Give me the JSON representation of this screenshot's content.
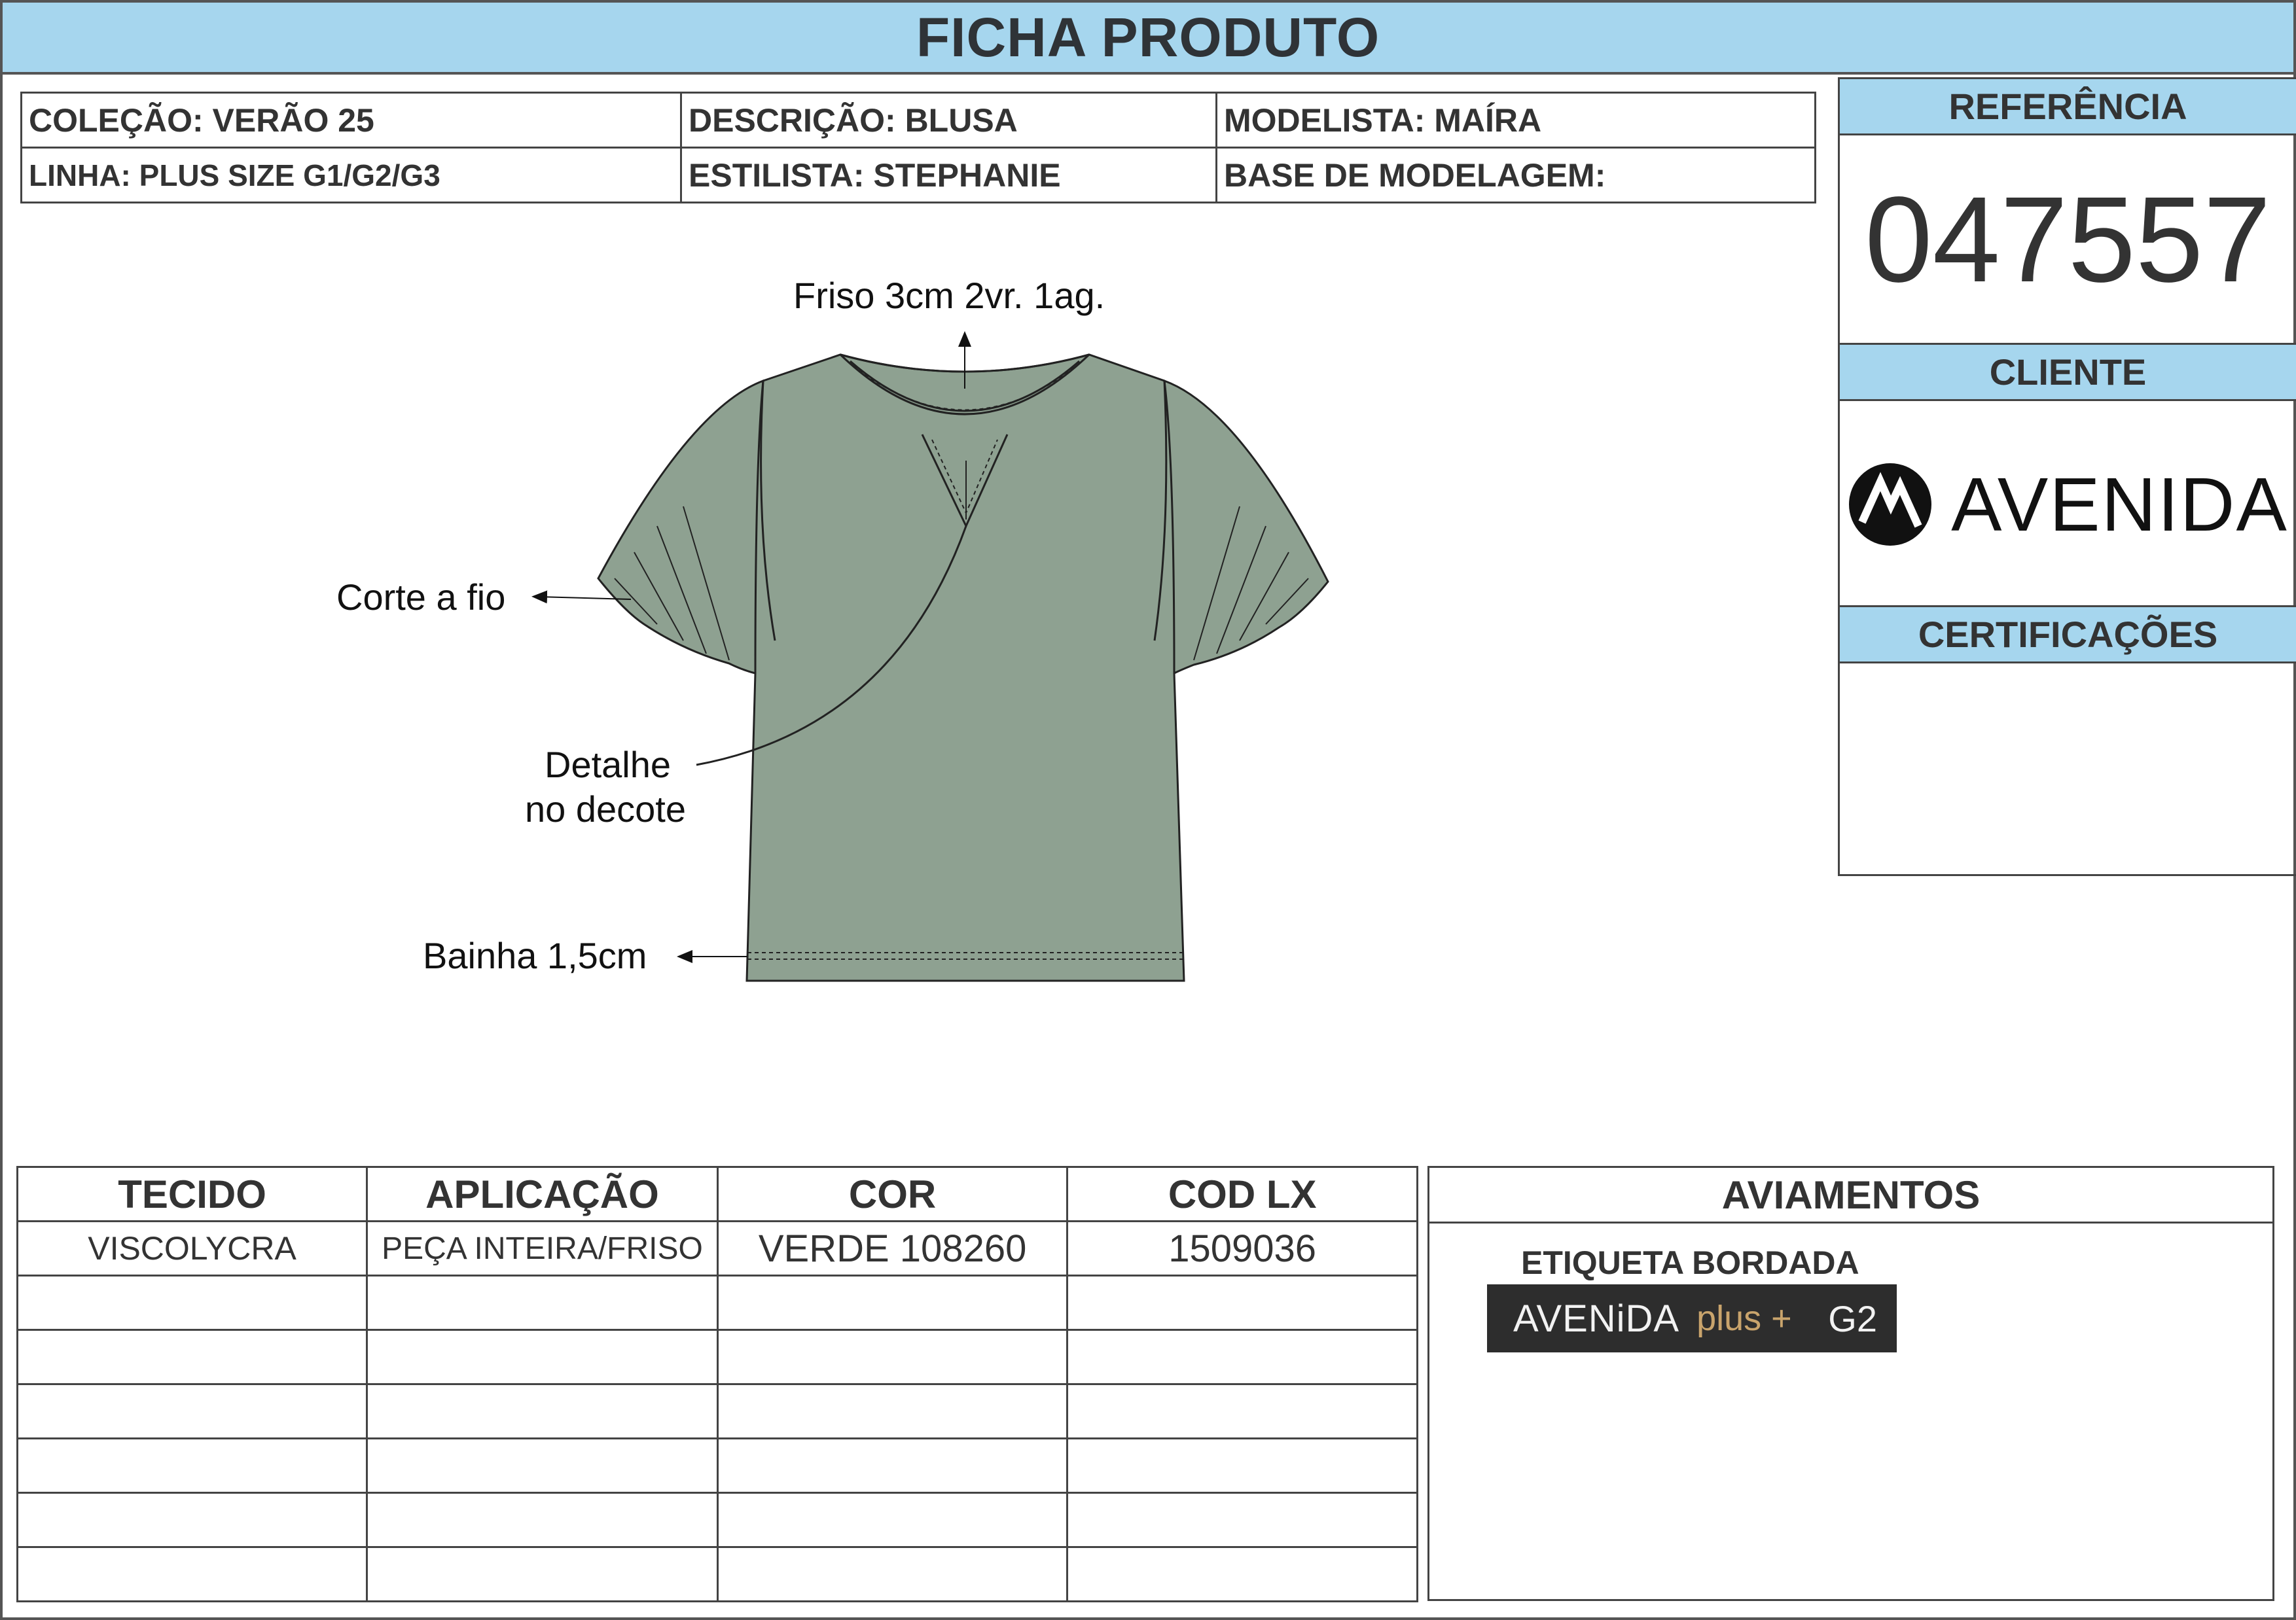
{
  "title": "FICHA PRODUTO",
  "info": {
    "colecao": "COLEÇÃO: VERÃO 25",
    "descricao": "DESCRIÇÃO: BLUSA",
    "modelista": "MODELISTA: MAÍRA",
    "linha": "LINHA: PLUS SIZE G1/G2/G3",
    "estilista": "ESTILISTA: STEPHANIE",
    "base": "BASE DE MODELAGEM:"
  },
  "referencia": {
    "label": "REFERÊNCIA",
    "value": "047557"
  },
  "cliente": {
    "label": "CLIENTE",
    "logo_text": "AVENIDA",
    "logo_icon": "avenida-logo-icon"
  },
  "certificacoes": {
    "label": "CERTIFICAÇÕES"
  },
  "garment": {
    "fill_color": "#8ea191",
    "callouts": {
      "friso": "Friso 3cm 2vr. 1ag.",
      "corte": "Corte a fio",
      "detalhe_1": "Detalhe",
      "detalhe_2": "no decote",
      "bainha": "Bainha 1,5cm"
    }
  },
  "fabric_table": {
    "headers": [
      "TECIDO",
      "APLICAÇÃO",
      "COR",
      "COD LX"
    ],
    "rows": [
      [
        "VISCOLYCRA",
        "PEÇA INTEIRA/FRISO",
        "VERDE 108260",
        "1509036"
      ]
    ]
  },
  "aviamentos": {
    "label": "AVIAMENTOS",
    "item": "ETIQUETA BORDADA",
    "tag_brand": "AVENiDA",
    "tag_plus": "plus +",
    "tag_size": "G2"
  },
  "colors": {
    "header_blue": "#a6d6ee",
    "border": "#444444"
  }
}
